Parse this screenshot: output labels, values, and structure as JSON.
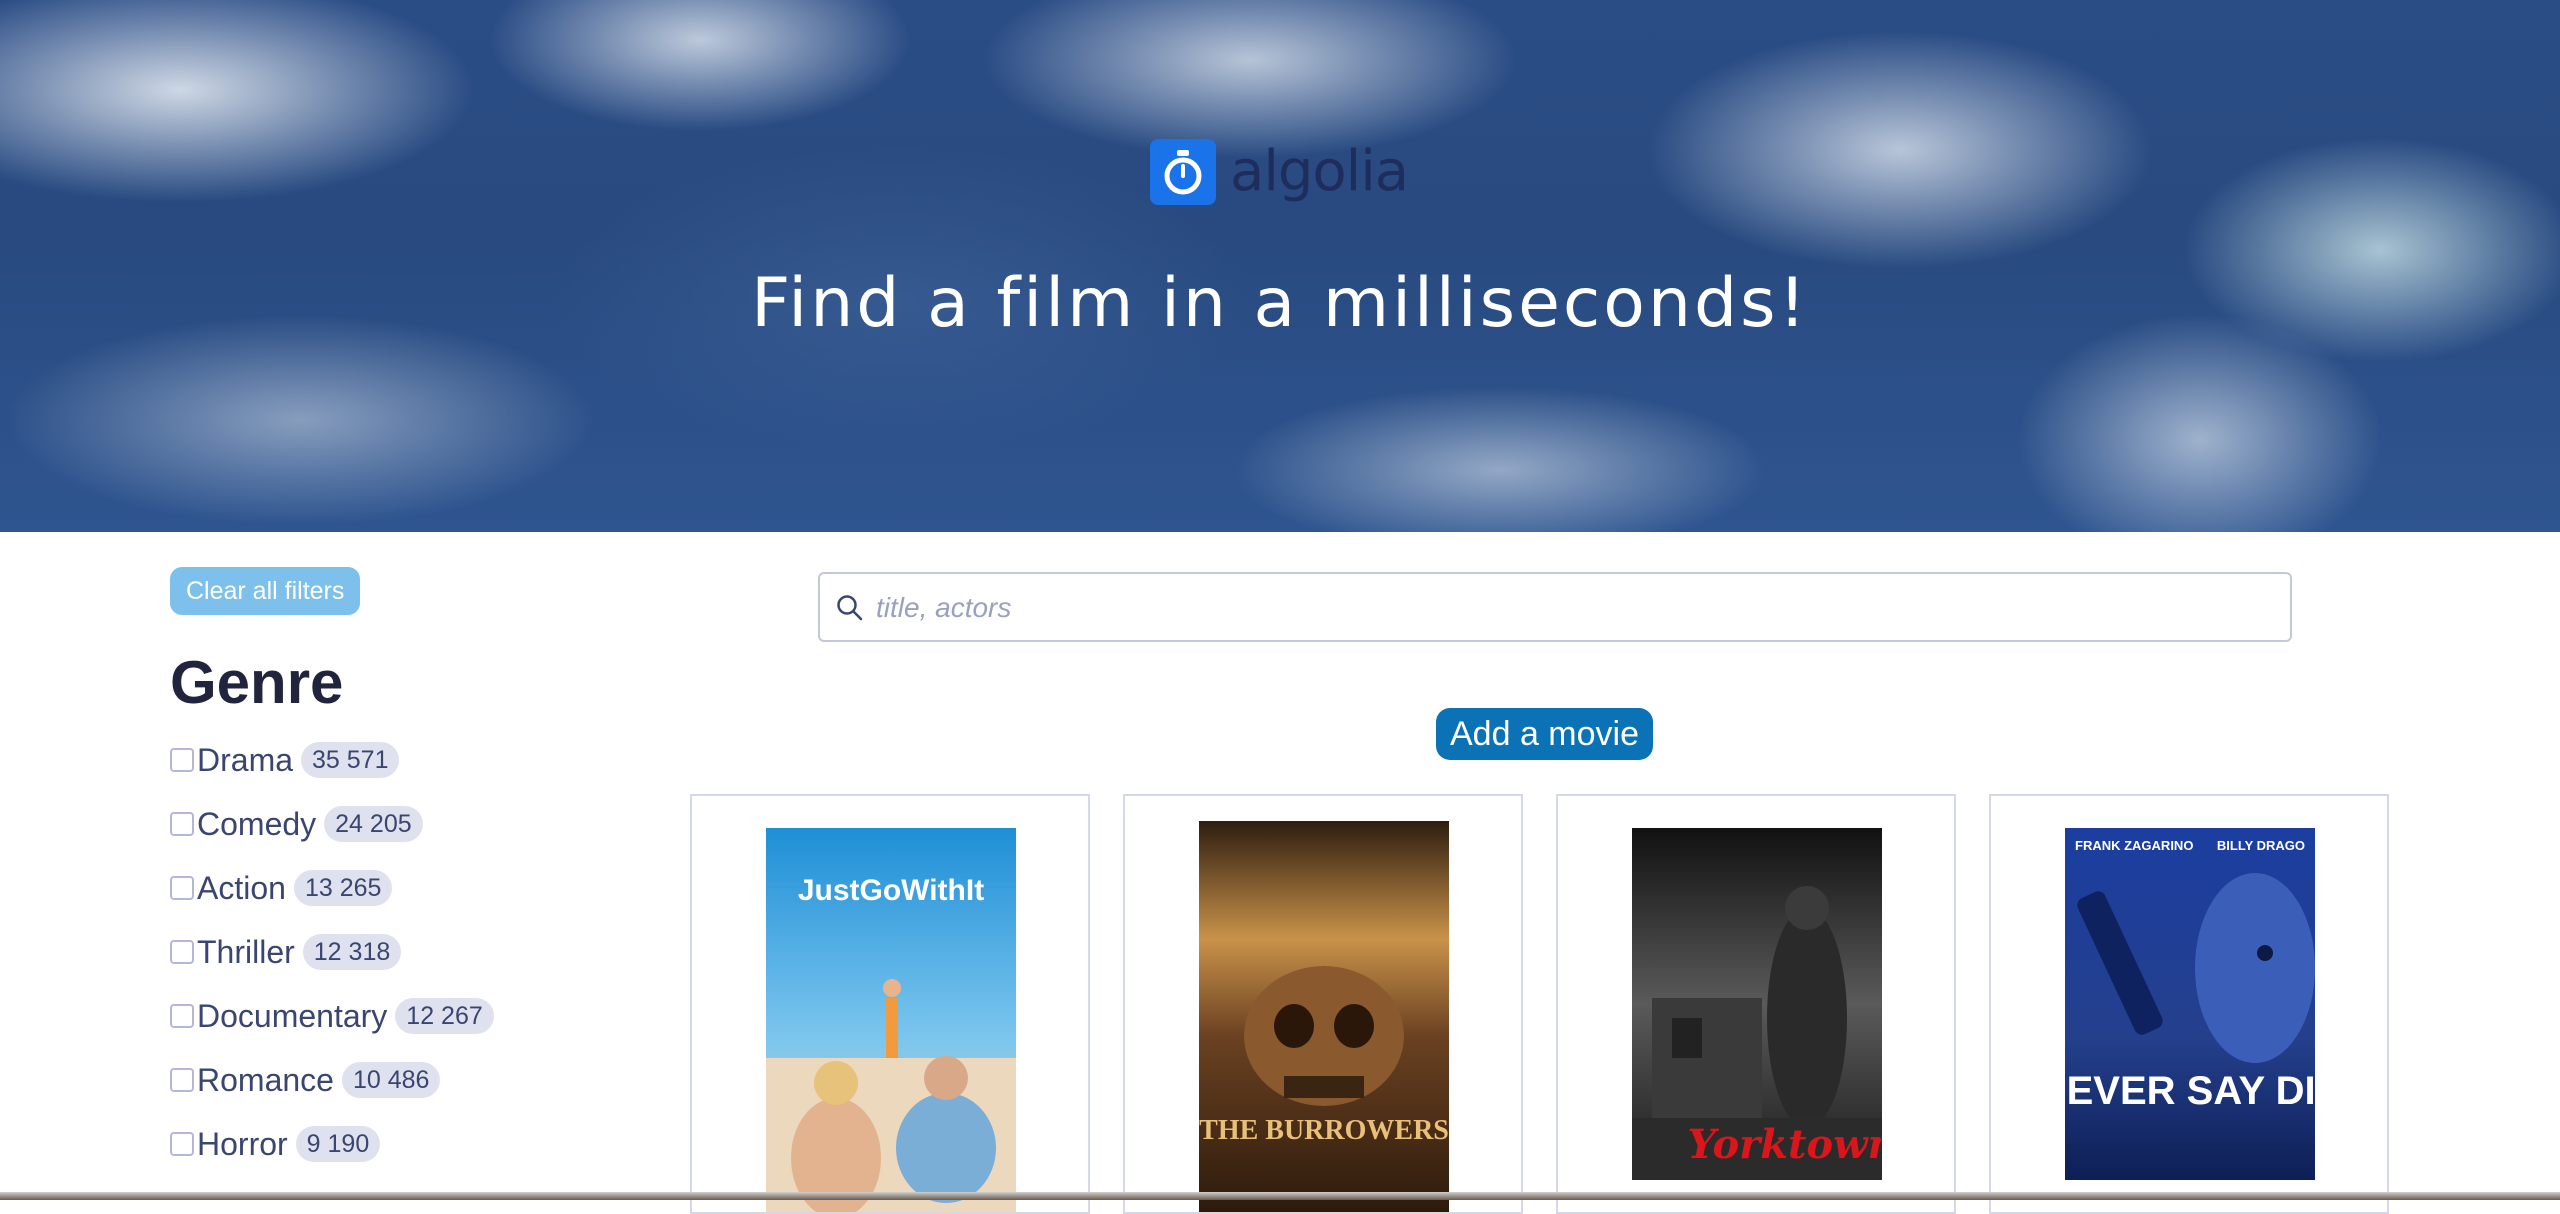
{
  "hero": {
    "brand": "algolia",
    "tagline": "Find a film in a milliseconds!"
  },
  "sidebar": {
    "clear_filters_label": "Clear all filters",
    "genre_title": "Genre",
    "genres": [
      {
        "label": "Drama",
        "count": "35 571",
        "checked": false
      },
      {
        "label": "Comedy",
        "count": "24 205",
        "checked": false
      },
      {
        "label": "Action",
        "count": "13 265",
        "checked": false
      },
      {
        "label": "Thriller",
        "count": "12 318",
        "checked": false
      },
      {
        "label": "Documentary",
        "count": "12 267",
        "checked": false
      },
      {
        "label": "Romance",
        "count": "10 486",
        "checked": false
      },
      {
        "label": "Horror",
        "count": "9 190",
        "checked": false
      }
    ]
  },
  "search": {
    "placeholder": "title, actors",
    "value": ""
  },
  "add_movie_label": "Add a movie",
  "movies": [
    {
      "poster_text": "JustGoWithIt"
    },
    {
      "poster_text": "THE BURROWERS"
    },
    {
      "poster_text": "Yorktown"
    },
    {
      "poster_text": "NEVER SAY DIE",
      "poster_credits": [
        "FRANK ZAGARINO",
        "BILLY DRAGO"
      ]
    }
  ],
  "colors": {
    "clear_button": "#7dc0ec",
    "add_button": "#0b73b5",
    "brand_blue": "#1a73e8"
  }
}
